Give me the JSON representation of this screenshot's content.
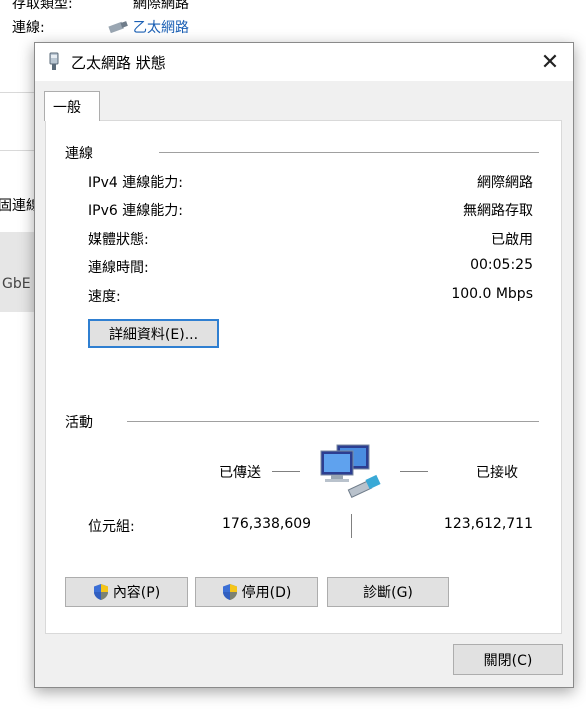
{
  "background": {
    "access_type_label": "存取類型:",
    "access_type_value": "網際網路",
    "connections_label": "連線:",
    "connection_link": "乙太網路",
    "partial_text_1": "固連線",
    "partial_text_2": "GbE"
  },
  "dialog": {
    "title": "乙太網路 狀態",
    "close_glyph": "✕",
    "tab_general": "一般",
    "connection_group": "連線",
    "rows": [
      {
        "label": "IPv4 連線能力:",
        "value": "網際網路"
      },
      {
        "label": "IPv6 連線能力:",
        "value": "無網路存取"
      },
      {
        "label": "媒體狀態:",
        "value": "已啟用"
      },
      {
        "label": "連線時間:",
        "value": "00:05:25"
      },
      {
        "label": "速度:",
        "value": "100.0 Mbps"
      }
    ],
    "details_button": "詳細資料(E)...",
    "activity_group": "活動",
    "sent_label": "已傳送",
    "received_label": "已接收",
    "bytes_label": "位元組:",
    "bytes_sent": "176,338,609",
    "bytes_received": "123,612,711",
    "properties_button": "內容(P)",
    "disable_button": "停用(D)",
    "diagnose_button": "診斷(G)",
    "close_button": "關閉(C)"
  },
  "colors": {
    "link": "#1a5fb4",
    "focus_border": "#2f7fd1",
    "button_face": "#e1e1e1",
    "dialog_bg": "#f0f0f0"
  },
  "icons": {
    "title": "network-adapter-icon",
    "activity": "network-computers-icon",
    "shield": "uac-shield-icon"
  }
}
